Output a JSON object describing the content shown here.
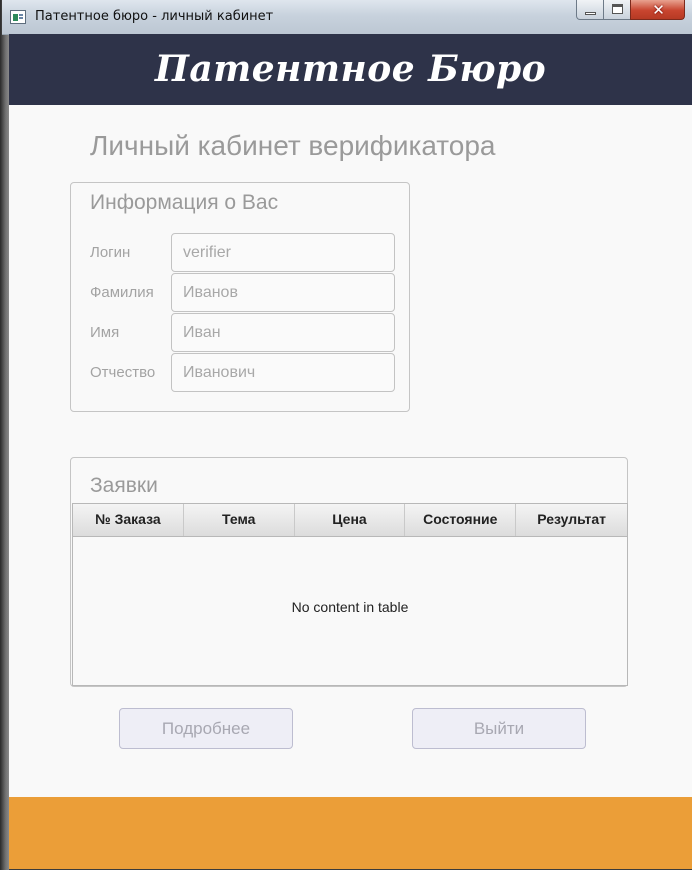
{
  "window": {
    "title": "Патентное бюро - личный кабинет",
    "controls": {
      "close_glyph": "✕"
    }
  },
  "header": {
    "brand": "Патентное Бюро",
    "bg_color": "#2e3349"
  },
  "page": {
    "title": "Личный кабинет верификатора"
  },
  "info": {
    "title": "Информация о Вас",
    "fields": [
      {
        "label": "Логин",
        "value": "verifier"
      },
      {
        "label": "Фамилия",
        "value": "Иванов"
      },
      {
        "label": "Имя",
        "value": "Иван"
      },
      {
        "label": "Отчество",
        "value": "Иванович"
      }
    ]
  },
  "orders": {
    "title": "Заявки",
    "columns": [
      "№ Заказа",
      "Тема",
      "Цена",
      "Состояние",
      "Результат"
    ],
    "rows": [],
    "empty_text": "No content in table"
  },
  "actions": {
    "details_label": "Подробнее",
    "exit_label": "Выйти"
  },
  "footer": {
    "color": "#eb9e38"
  }
}
